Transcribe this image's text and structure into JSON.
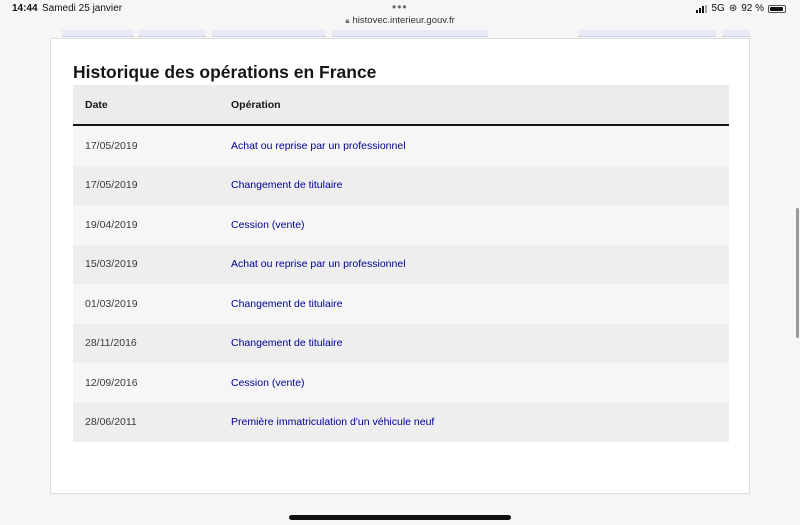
{
  "status_bar": {
    "time": "14:44",
    "date": "Samedi 25 janvier",
    "url": "histovec.interieur.gouv.fr",
    "network": "5G",
    "battery": "92 %"
  },
  "section": {
    "title": "Historique des opérations en France"
  },
  "table": {
    "headers": {
      "date": "Date",
      "operation": "Opération"
    },
    "rows": [
      {
        "date": "17/05/2019",
        "operation": "Achat ou reprise par un professionnel"
      },
      {
        "date": "17/05/2019",
        "operation": "Changement de titulaire"
      },
      {
        "date": "19/04/2019",
        "operation": "Cession (vente)"
      },
      {
        "date": "15/03/2019",
        "operation": "Achat ou reprise par un professionnel"
      },
      {
        "date": "01/03/2019",
        "operation": "Changement de titulaire"
      },
      {
        "date": "28/11/2016",
        "operation": "Changement de titulaire"
      },
      {
        "date": "12/09/2016",
        "operation": "Cession (vente)"
      },
      {
        "date": "28/06/2011",
        "operation": "Première immatriculation d'un véhicule neuf"
      }
    ]
  },
  "colors": {
    "link": "#000091",
    "text": "#161616",
    "header_bg": "#ececec",
    "row_odd": "#f6f6f6",
    "row_even": "#eeeeee"
  }
}
